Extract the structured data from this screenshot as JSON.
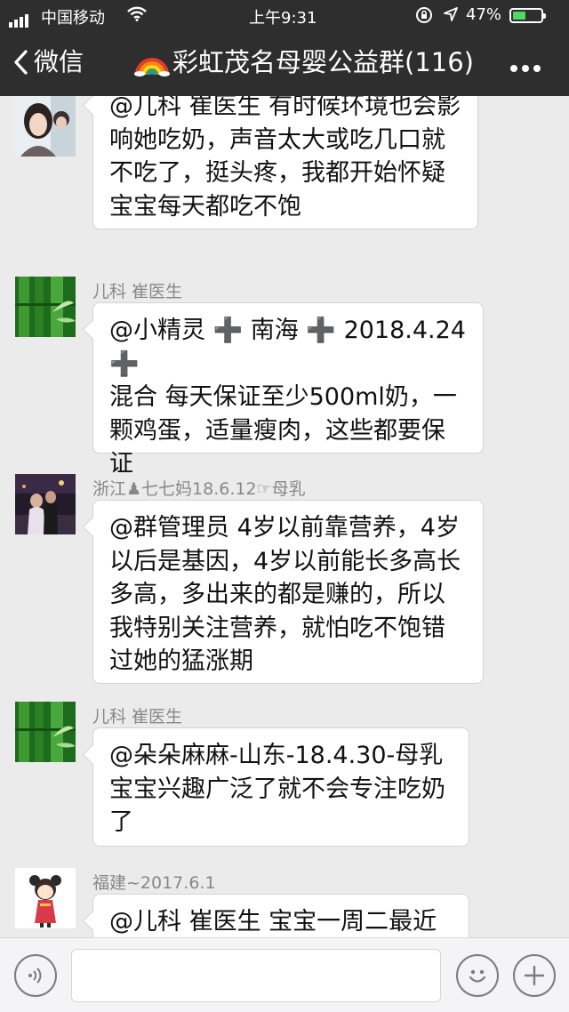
{
  "status_bar": {
    "carrier": "中国移动",
    "time": "上午9:31",
    "battery_percent": "47%",
    "battery_level": 0.47,
    "battery_color": "#4cd964"
  },
  "nav": {
    "back_label": "微信",
    "title": "彩虹茂名母婴公益群(116)",
    "icons": [
      "chevron-left-icon",
      "rainbow-emoji",
      "more-dots-icon"
    ]
  },
  "messages": [
    {
      "sender": "",
      "avatar": "avatar-girl-photo",
      "lines": [
        "@儿科 崔医生 有时候环境也会影",
        "响她吃奶，声音太大或吃几口就",
        "不吃了，挺头疼，我都开始怀疑",
        "宝宝每天都吃不饱"
      ]
    },
    {
      "sender": "儿科 崔医生",
      "avatar": "avatar-bamboo",
      "lines": [
        "@小精灵 ➕ 南海 ➕ 2018.4.24 ➕",
        "混合 每天保证至少500ml奶，一",
        "颗鸡蛋，适量瘦肉，这些都要保",
        "证"
      ]
    },
    {
      "sender": "浙江♟七七妈18.6.12☞母乳",
      "avatar": "avatar-night-couple-photo",
      "lines": [
        "@群管理员 4岁以前靠营养，4岁",
        "以后是基因，4岁以前能长多高长",
        "多高，多出来的都是赚的，所以",
        "我特别关注营养，就怕吃不饱错",
        "过她的猛涨期"
      ]
    },
    {
      "sender": "儿科 崔医生",
      "avatar": "avatar-bamboo",
      "lines": [
        "@朵朵麻麻-山东-18.4.30-母乳",
        "宝宝兴趣广泛了就不会专注吃奶",
        "了"
      ]
    },
    {
      "sender": "福建~2017.6.1",
      "avatar": "avatar-cartoon-girl",
      "lines": [
        "@儿科 崔医生   宝宝一周二最近"
      ]
    }
  ],
  "input_bar": {
    "icons": [
      "voice-icon",
      "emoji-icon",
      "plus-icon"
    ]
  },
  "colors": {
    "header_bg": "#2e2e2e",
    "chat_bg": "#ebebeb",
    "bubble_bg": "#ffffff",
    "bamboo_green": "#2f8a2a"
  }
}
